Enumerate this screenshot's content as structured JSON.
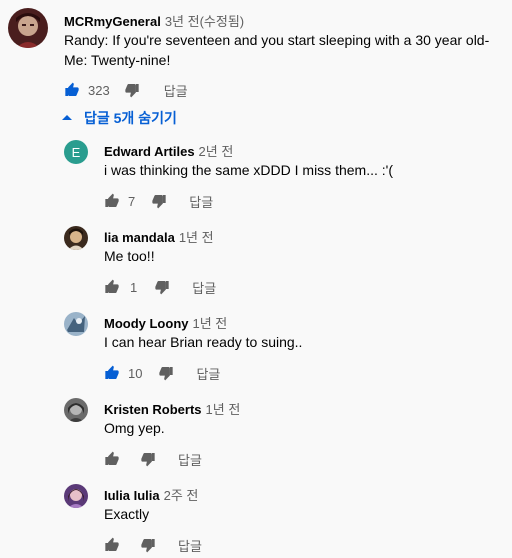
{
  "top_comment": {
    "author": "MCRmyGeneral",
    "time": "3년 전(수정됨)",
    "lines": [
      "Randy: If you're seventeen and you start sleeping with a 30 year old-",
      "Me: Twenty-nine!"
    ],
    "likes": "323",
    "reply_label": "답글",
    "like_icon": "thumb-up-filled-icon",
    "like_color": "#065fd4"
  },
  "toggle_replies": {
    "label": "답글 5개 숨기기",
    "icon": "caret-up-icon",
    "color": "#065fd4"
  },
  "replies": [
    {
      "author": "Edward Artiles",
      "time": "2년 전",
      "text": "i was thinking the same xDDD I miss them... :'(",
      "likes": "7",
      "reply_label": "답글",
      "avatar_letter": "E",
      "avatar_color": "#2a9d8f",
      "liked": false
    },
    {
      "author": "lia mandala",
      "time": "1년 전",
      "text": "Me too!!",
      "likes": "1",
      "reply_label": "답글",
      "liked": false
    },
    {
      "author": "Moody Loony",
      "time": "1년 전",
      "text": "I can hear Brian ready to suing..",
      "likes": "10",
      "reply_label": "답글",
      "liked": true
    },
    {
      "author": "Kristen Roberts",
      "time": "1년 전",
      "text": "Omg yep.",
      "likes": "",
      "reply_label": "답글",
      "liked": false
    },
    {
      "author": "Iulia Iulia",
      "time": "2주 전",
      "text": "Exactly",
      "likes": "",
      "reply_label": "답글",
      "liked": false
    }
  ]
}
